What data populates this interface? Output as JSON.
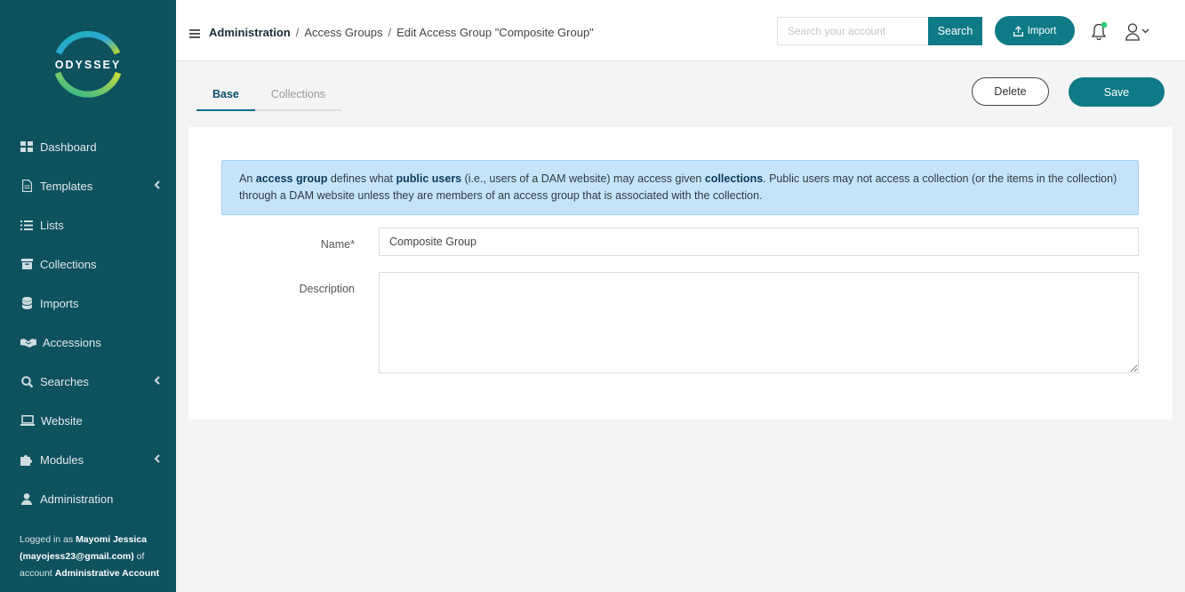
{
  "app": {
    "logo_text": "ODYSSEY"
  },
  "sidebar": {
    "items": [
      {
        "label": "Dashboard",
        "icon": "dashboard-icon"
      },
      {
        "label": "Templates",
        "icon": "document-icon",
        "expandable": true
      },
      {
        "label": "Lists",
        "icon": "list-icon"
      },
      {
        "label": "Collections",
        "icon": "archive-icon"
      },
      {
        "label": "Imports",
        "icon": "database-icon"
      },
      {
        "label": "Accessions",
        "icon": "handshake-icon"
      },
      {
        "label": "Searches",
        "icon": "search-icon",
        "expandable": true
      },
      {
        "label": "Website",
        "icon": "laptop-icon"
      },
      {
        "label": "Modules",
        "icon": "puzzle-icon",
        "expandable": true
      },
      {
        "label": "Administration",
        "icon": "user-icon"
      }
    ],
    "login": {
      "prefix": "Logged in as ",
      "user": "Mayomi Jessica",
      "email": "(mayojess23@gmail.com)",
      "of_account": " of account ",
      "account": "Administrative Account"
    }
  },
  "header": {
    "breadcrumb": {
      "root": "Administration",
      "level2": "Access Groups",
      "current": "Edit Access Group \"Composite Group\"",
      "separator": "/"
    },
    "search": {
      "placeholder": "Search your account",
      "button": "Search"
    },
    "import_label": "Import"
  },
  "tabs": [
    {
      "label": "Base",
      "active": true
    },
    {
      "label": "Collections",
      "active": false
    }
  ],
  "actions": {
    "delete": "Delete",
    "save": "Save"
  },
  "alert": {
    "t1": "An ",
    "b1": "access group",
    "t2": " defines what ",
    "b2": "public users",
    "t3": " (i.e., users of a DAM website) may access given ",
    "b3": "collections",
    "t4": ". Public users may not access a collection (or the items in the collection) through a DAM website unless they are members of an access group that is associated with the collection."
  },
  "form": {
    "name_label": "Name*",
    "name_value": "Composite Group",
    "description_label": "Description",
    "description_value": ""
  },
  "colors": {
    "sidebar": "#0e525e",
    "accent": "#0e7a86",
    "alert_bg": "#c5e4fa",
    "notification_dot": "#2ecc71"
  }
}
